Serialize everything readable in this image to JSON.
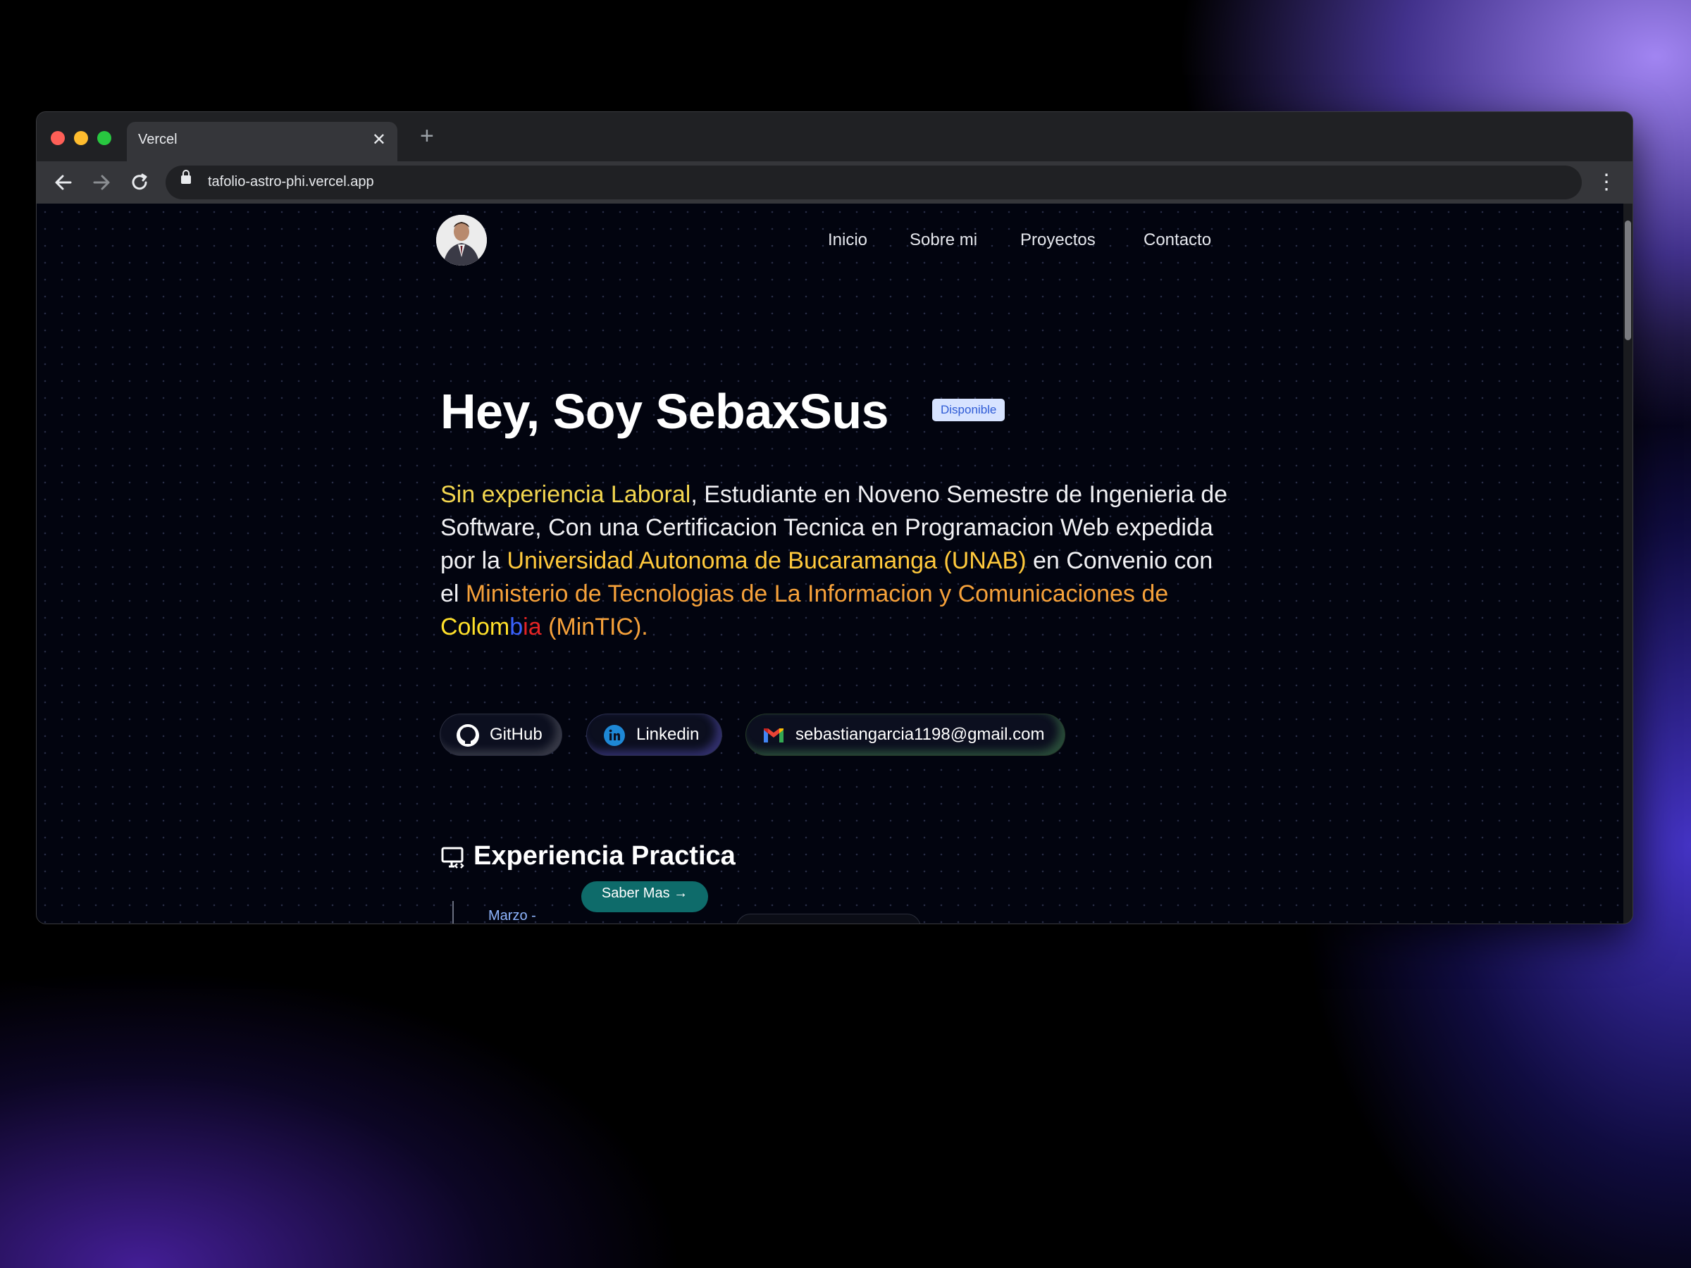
{
  "browser": {
    "tab_title": "Vercel",
    "tab_close": "✕",
    "new_tab": "+",
    "url": "tafolio-astro-phi.vercel.app"
  },
  "site": {
    "nav": [
      "Inicio",
      "Sobre mi",
      "Proyectos",
      "Contacto"
    ],
    "hero_title": "Hey, Soy SebaxSus",
    "badge": "Disponible",
    "bio": {
      "p1": "Sin experiencia Laboral",
      "p2": ", Estudiante en Noveno Semestre de Ingenieria de Software, Con una Certificacion Tecnica en Programacion Web expedida por la ",
      "p3": "Universidad Autonoma de Bucaramanga (UNAB)",
      "p4": " en Convenio con el ",
      "p5": "Ministerio de Tecnologias de La Informacion y Comunicaciones de ",
      "colombia_y": "Colom",
      "colombia_b": "b",
      "colombia_r": "ia",
      "p6": " (MinTIC)."
    },
    "links": {
      "github": "GitHub",
      "linkedin": "Linkedin",
      "email": "sebastiangarcia1198@gmail.com"
    },
    "section_title": "Experiencia Practica",
    "timeline_date": "Marzo -",
    "saber_mas": "Saber Mas →"
  },
  "colors": {
    "highlight_yellow": "#f3d64f",
    "highlight_gold": "#ffc93c",
    "highlight_orange": "#f6a13a",
    "badge_bg": "#d7e3ff",
    "badge_text": "#2e5bd6",
    "teal_button": "#0e6b6a"
  },
  "icons": {
    "github": "github-icon",
    "linkedin": "linkedin-icon",
    "gmail": "gmail-icon",
    "section": "monitor-code-icon"
  }
}
